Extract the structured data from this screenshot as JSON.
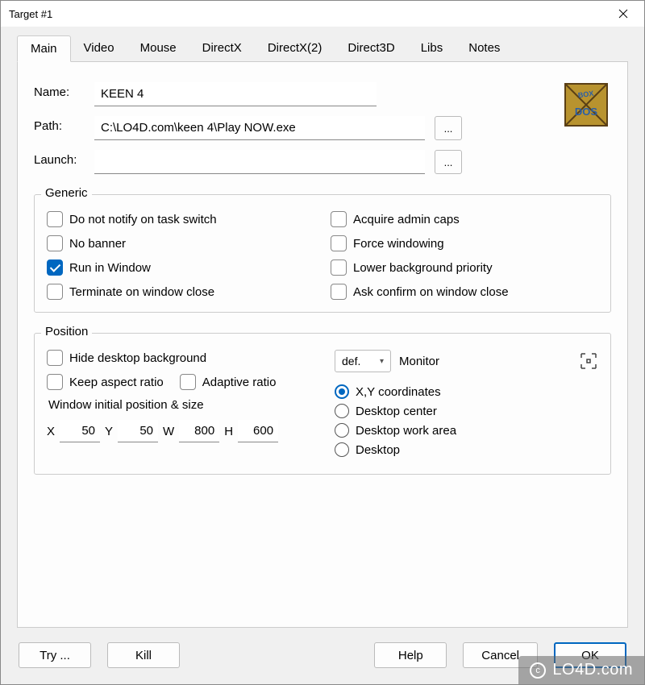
{
  "window": {
    "title": "Target #1"
  },
  "tabs": [
    {
      "label": "Main",
      "active": true
    },
    {
      "label": "Video"
    },
    {
      "label": "Mouse"
    },
    {
      "label": "DirectX"
    },
    {
      "label": "DirectX(2)"
    },
    {
      "label": "Direct3D"
    },
    {
      "label": "Libs"
    },
    {
      "label": "Notes"
    }
  ],
  "fields": {
    "name": {
      "label": "Name:",
      "value": "KEEN 4"
    },
    "path": {
      "label": "Path:",
      "value": "C:\\LO4D.com\\keen 4\\Play NOW.exe"
    },
    "launch": {
      "label": "Launch:",
      "value": ""
    },
    "browse": "..."
  },
  "icon": {
    "name": "dosbox-icon",
    "colors": {
      "bg": "#b8932f",
      "border": "#5a3f15",
      "text": "#3e2a10"
    }
  },
  "generic": {
    "title": "Generic",
    "left": [
      {
        "label": "Do not notify on task switch",
        "checked": false
      },
      {
        "label": "No banner",
        "checked": false
      },
      {
        "label": "Run in Window",
        "checked": true
      },
      {
        "label": "Terminate on window close",
        "checked": false
      }
    ],
    "right": [
      {
        "label": "Acquire admin caps",
        "checked": false
      },
      {
        "label": "Force windowing",
        "checked": false
      },
      {
        "label": "Lower background priority",
        "checked": false
      },
      {
        "label": "Ask confirm on window close",
        "checked": false
      }
    ]
  },
  "position": {
    "title": "Position",
    "hide_desktop": {
      "label": "Hide desktop background",
      "checked": false
    },
    "keep_aspect": {
      "label": "Keep aspect ratio",
      "checked": false
    },
    "adaptive": {
      "label": "Adaptive ratio",
      "checked": false
    },
    "init_label": "Window initial position & size",
    "coords": {
      "x_label": "X",
      "x": "50",
      "y_label": "Y",
      "y": "50",
      "w_label": "W",
      "w": "800",
      "h_label": "H",
      "h": "600"
    },
    "monitor": {
      "combo": "def.",
      "label": "Monitor"
    },
    "radios": [
      {
        "label": "X,Y coordinates",
        "checked": true
      },
      {
        "label": "Desktop center",
        "checked": false
      },
      {
        "label": "Desktop work area",
        "checked": false
      },
      {
        "label": "Desktop",
        "checked": false
      }
    ]
  },
  "buttons": {
    "try": "Try ...",
    "kill": "Kill",
    "help": "Help",
    "cancel": "Cancel",
    "ok": "OK"
  },
  "watermark": "LO4D.com"
}
